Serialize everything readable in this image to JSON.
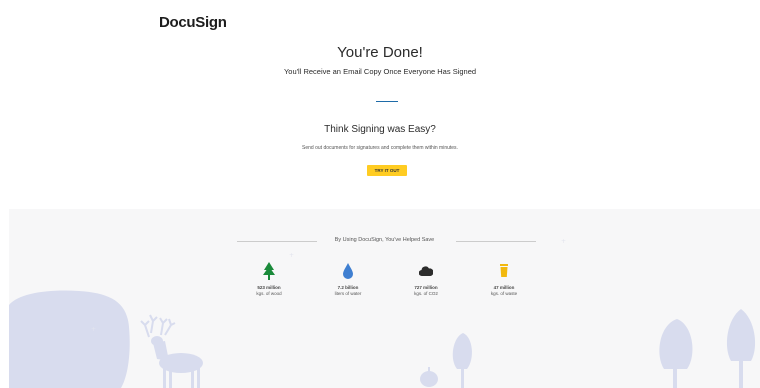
{
  "brand": {
    "logo_text": "DocuSign"
  },
  "completion": {
    "title": "You're Done!",
    "subtitle": "You'll Receive an Email Copy Once Everyone Has Signed"
  },
  "promo": {
    "title": "Think Signing was Easy?",
    "text": "Send out documents for signatures and complete them within minutes.",
    "button_label": "TRY IT OUT",
    "button_color": "#ffcc22"
  },
  "impact": {
    "heading": "By Using DocuSign, You've Helped Save",
    "stats": [
      {
        "icon": "tree-icon",
        "value": "523 million",
        "unit": "kgs. of wood",
        "color": "#1a8a3a"
      },
      {
        "icon": "water-drop-icon",
        "value": "7.2 billion",
        "unit": "liters of water",
        "color": "#3f7fd1"
      },
      {
        "icon": "cloud-icon",
        "value": "727 million",
        "unit": "kgs. of CO2",
        "color": "#2c2c2c"
      },
      {
        "icon": "trash-can-icon",
        "value": "47 million",
        "unit": "kgs. of waste",
        "color": "#f2b90f"
      }
    ],
    "illustration_color": "#d8dcee"
  }
}
